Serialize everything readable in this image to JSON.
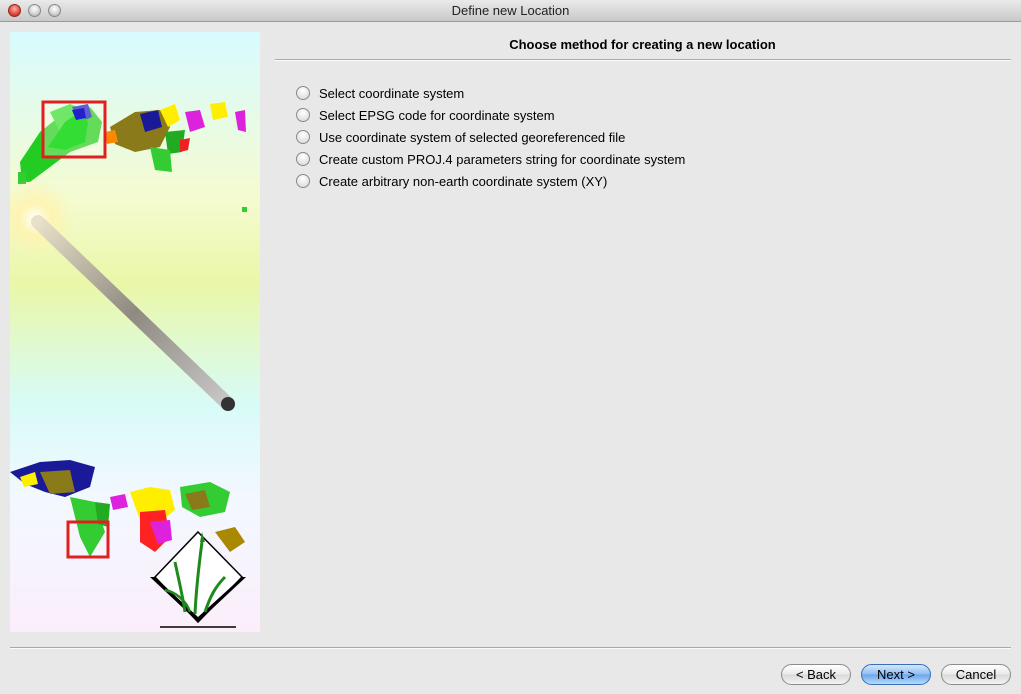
{
  "window": {
    "title": "Define new Location"
  },
  "heading": "Choose method for creating a new location",
  "options": [
    {
      "label": "Select coordinate system"
    },
    {
      "label": "Select EPSG code for coordinate system"
    },
    {
      "label": "Use coordinate system of selected georeferenced file"
    },
    {
      "label": "Create custom PROJ.4 parameters string for coordinate system"
    },
    {
      "label": "Create arbitrary non-earth coordinate system (XY)"
    }
  ],
  "buttons": {
    "back": "< Back",
    "next": "Next >",
    "cancel": "Cancel"
  },
  "sidebar": {
    "image": "grass-gis-location-wizard-illustration"
  }
}
